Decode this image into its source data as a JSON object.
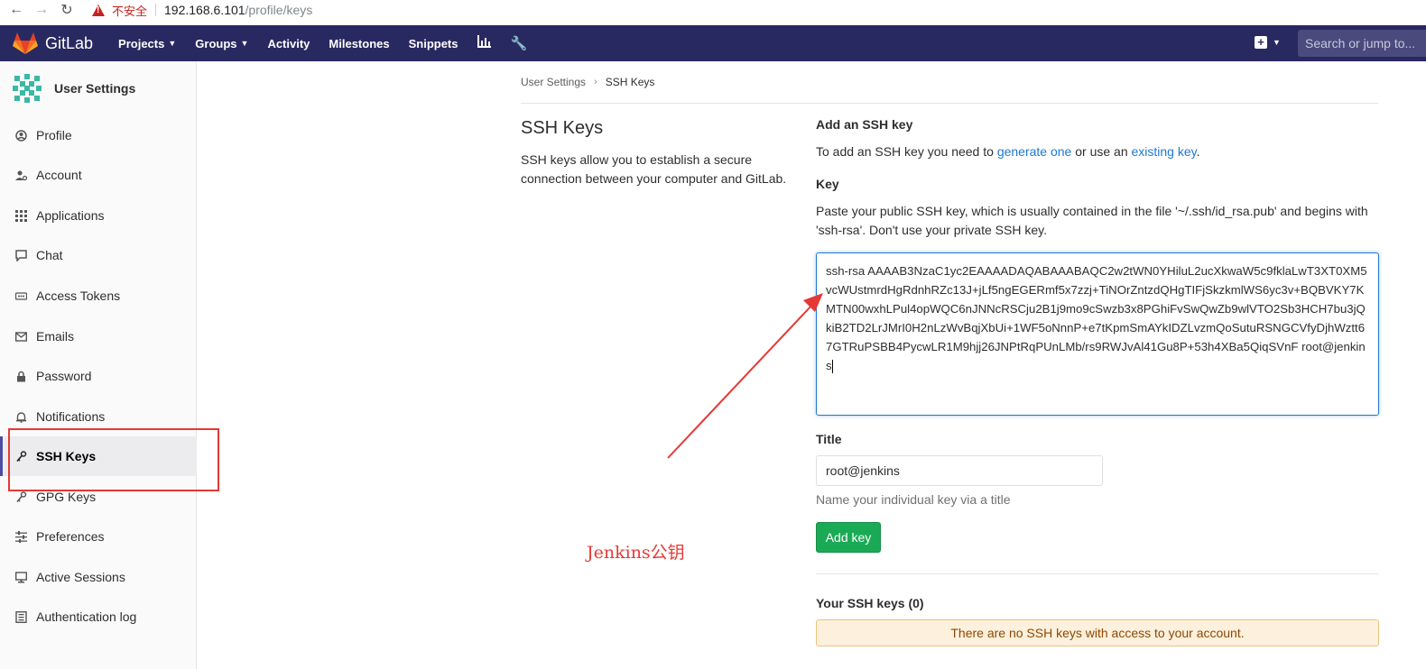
{
  "browser": {
    "security_label": "不安全",
    "url_host": "192.168.6.101",
    "url_path": "/profile/keys"
  },
  "topnav": {
    "brand": "GitLab",
    "items": [
      "Projects",
      "Groups",
      "Activity",
      "Milestones",
      "Snippets"
    ],
    "search_placeholder": "Search or jump to..."
  },
  "sidebar": {
    "title": "User Settings",
    "items": [
      {
        "label": "Profile",
        "icon": "profile-icon"
      },
      {
        "label": "Account",
        "icon": "account-icon"
      },
      {
        "label": "Applications",
        "icon": "applications-icon"
      },
      {
        "label": "Chat",
        "icon": "chat-icon"
      },
      {
        "label": "Access Tokens",
        "icon": "access-tokens-icon"
      },
      {
        "label": "Emails",
        "icon": "emails-icon"
      },
      {
        "label": "Password",
        "icon": "password-icon"
      },
      {
        "label": "Notifications",
        "icon": "notifications-icon"
      },
      {
        "label": "SSH Keys",
        "icon": "ssh-key-icon",
        "active": true
      },
      {
        "label": "GPG Keys",
        "icon": "gpg-key-icon"
      },
      {
        "label": "Preferences",
        "icon": "preferences-icon"
      },
      {
        "label": "Active Sessions",
        "icon": "active-sessions-icon"
      },
      {
        "label": "Authentication log",
        "icon": "authentication-log-icon"
      }
    ]
  },
  "breadcrumb": {
    "parent": "User Settings",
    "current": "SSH Keys"
  },
  "section": {
    "title": "SSH Keys",
    "description": "SSH keys allow you to establish a secure connection between your computer and GitLab."
  },
  "form": {
    "add_title": "Add an SSH key",
    "add_desc_pre": "To add an SSH key you need to ",
    "add_desc_link1": "generate one",
    "add_desc_mid": " or use an ",
    "add_desc_link2": "existing key",
    "add_desc_post": ".",
    "key_label": "Key",
    "key_help": "Paste your public SSH key, which is usually contained in the file '~/.ssh/id_rsa.pub' and begins with 'ssh-rsa'. Don't use your private SSH key.",
    "key_value": "ssh-rsa AAAAB3NzaC1yc2EAAAADAQABAAABAQC2w2tWN0YHiluL2ucXkwaW5c9fklaLwT3XT0XM5vcWUstmrdHgRdnhRZc13J+jLf5ngEGERmf5x7zzj+TiNOrZntzdQHgTIFjSkzkmlWS6yc3v+BQBVKY7KMTN00wxhLPul4opWQC6nJNNcRSCju2B1j9mo9cSwzb3x8PGhiFvSwQwZb9wlVTO2Sb3HCH7bu3jQkiB2TD2LrJMrI0H2nLzWvBqjXbUi+1WF5oNnnP+e7tKpmSmAYkIDZLvzmQoSutuRSNGCVfyDjhWztt67GTRuPSBB4PycwLR1M9hjj26JNPtRqPUnLMb/rs9RWJvAl41Gu8P+53h4XBa5QiqSVnF root@jenkins",
    "title_label": "Title",
    "title_value": "root@jenkins",
    "title_help": "Name your individual key via a title",
    "add_button": "Add key",
    "your_keys_title": "Your SSH keys (0)",
    "empty_message": "There are no SSH keys with access to your account."
  },
  "annotation": {
    "text": "Jenkins公钥",
    "color": "#e53935"
  },
  "colors": {
    "nav_bg": "#292961",
    "accent": "#1f78d1",
    "success": "#1aaa55",
    "warning_bg": "#fdf1dd"
  }
}
